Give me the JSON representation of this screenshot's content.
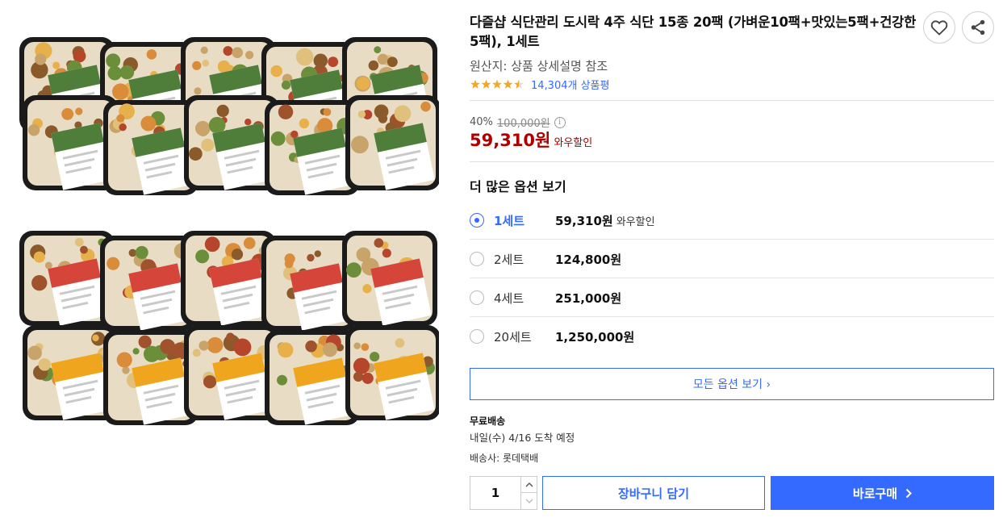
{
  "product": {
    "title": "다즐샵 식단관리 도시락 4주 식단 15종 20팩 (가벼운10팩+맛있는5팩+건강한5팩), 1세트",
    "origin": "원산지: 상품 상세설명 참조",
    "rating_value": 4.5,
    "review_count": "14,304개 상품평",
    "image_icon": "product-photo-meal-boxes"
  },
  "pricing": {
    "discount_rate": "40%",
    "original_price": "100,000원",
    "sale_price": "59,310원",
    "sale_tag": "와우할인"
  },
  "options": {
    "heading": "더 많은 옵션 보기",
    "items": [
      {
        "label": "1세트",
        "price": "59,310원",
        "tag": "와우할인",
        "selected": true
      },
      {
        "label": "2세트",
        "price": "124,800원",
        "tag": "",
        "selected": false
      },
      {
        "label": "4세트",
        "price": "251,000원",
        "tag": "",
        "selected": false
      },
      {
        "label": "20세트",
        "price": "1,250,000원",
        "tag": "",
        "selected": false
      }
    ],
    "all_button": "모든 옵션 보기 ›"
  },
  "shipping": {
    "free_label": "무료배송",
    "arrival": "내일(수) 4/16 도착 예정",
    "carrier": "배송사: 롯데택배"
  },
  "purchase": {
    "quantity": "1",
    "cart_label": "장바구니 담기",
    "buy_label": "바로구매"
  },
  "colors": {
    "accent": "#346aff",
    "price_red": "#ae0000",
    "star": "#f5a623"
  }
}
